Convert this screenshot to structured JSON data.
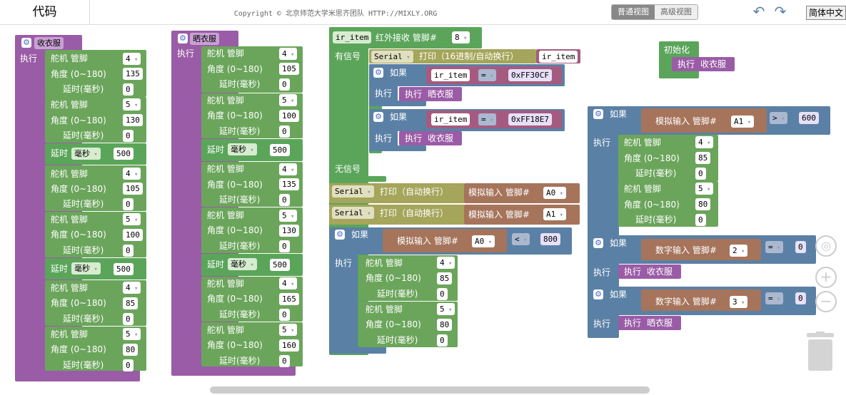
{
  "header": {
    "tab_code": "代码",
    "copyright": "Copyright © 北京师范大学米思齐团队 HTTP://MIXLY.ORG",
    "view_normal": "普通视图",
    "view_advanced": "高级视图",
    "language": "简体中文"
  },
  "labels": {
    "exec": "执行",
    "servo": "舵机 管脚",
    "angle": "角度 (0~180)",
    "delay_ms": "延时(毫秒)",
    "delay": "延时",
    "ms_unit": "毫秒",
    "if": "如果",
    "execute_call": "执行",
    "has_signal": "有信号",
    "no_signal": "无信号",
    "serial": "Serial",
    "print_hex": "打印（16进制/自动换行）",
    "print_newline": "打印（自动换行）",
    "analog_in": "模拟输入 管脚#",
    "digital_in": "数字输入 管脚#",
    "eq": "=",
    "gt": ">",
    "lt": "<",
    "ir_item": "ir_item",
    "ir_receive": "红外接收 管脚#",
    "init": "初始化"
  },
  "functions": {
    "collect": "收衣服",
    "dry": "晒衣服"
  },
  "collect_values": {
    "s1_pin": "4",
    "s1_angle": "135",
    "s1_delay": "0",
    "s2_pin": "5",
    "s2_angle": "130",
    "s2_delay": "0",
    "d1": "500",
    "s3_pin": "4",
    "s3_angle": "105",
    "s3_delay": "0",
    "s4_pin": "5",
    "s4_angle": "100",
    "s4_delay": "0",
    "d2": "500",
    "s5_pin": "4",
    "s5_angle": "85",
    "s5_delay": "0",
    "s6_pin": "5",
    "s6_angle": "80",
    "s6_delay": "0"
  },
  "dry_values": {
    "s1_pin": "4",
    "s1_angle": "105",
    "s1_delay": "0",
    "s2_pin": "5",
    "s2_angle": "100",
    "s2_delay": "0",
    "d1": "500",
    "s3_pin": "4",
    "s3_angle": "135",
    "s3_delay": "0",
    "s4_pin": "5",
    "s4_angle": "130",
    "s4_delay": "0",
    "d2": "500",
    "s5_pin": "4",
    "s5_angle": "165",
    "s5_delay": "0",
    "s6_pin": "5",
    "s6_angle": "160",
    "s6_delay": "0"
  },
  "ir_block": {
    "pin": "8",
    "code1": "0xFF30CF",
    "code2": "0xFF18E7",
    "a0": "A0",
    "a1": "A1",
    "threshold": "800",
    "s1_pin": "4",
    "s1_angle": "85",
    "s1_delay": "0",
    "s2_pin": "5",
    "s2_angle": "80",
    "s2_delay": "0"
  },
  "right_block": {
    "a1": "A1",
    "threshold": "600",
    "s1_pin": "4",
    "s1_angle": "85",
    "s1_delay": "0",
    "s2_pin": "5",
    "s2_angle": "80",
    "s2_delay": "0",
    "d_pin1": "2",
    "d_val1": "0",
    "d_pin2": "3",
    "d_val2": "0"
  }
}
